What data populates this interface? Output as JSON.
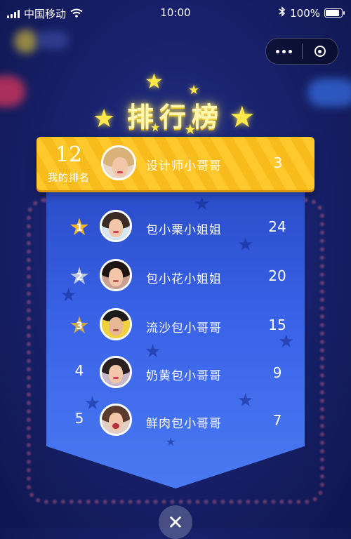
{
  "status_bar": {
    "carrier": "中国移动",
    "time": "10:00",
    "battery": "100%",
    "battery_level": 1.0
  },
  "capsule": {
    "more_icon": "more-dots-icon",
    "close_icon": "target-circle-icon"
  },
  "title": "排行榜",
  "my_rank": {
    "rank": "12",
    "label": "我的排名",
    "name": "设计师小哥哥",
    "score": "3"
  },
  "rows": [
    {
      "rank": "1",
      "medal": "gold",
      "name": "包小栗小姐姐",
      "score": "24"
    },
    {
      "rank": "2",
      "medal": "silver",
      "name": "包小花小姐姐",
      "score": "20"
    },
    {
      "rank": "3",
      "medal": "bronze",
      "name": "流沙包小哥哥",
      "score": "15"
    },
    {
      "rank": "4",
      "medal": "",
      "name": "奶黄包小哥哥",
      "score": "9"
    },
    {
      "rank": "5",
      "medal": "",
      "name": "鲜肉包小哥哥",
      "score": "7"
    }
  ],
  "colors": {
    "gold": "#f5b823",
    "silver": "#b9c8dd",
    "bronze": "#c9a74a",
    "banner": "#ffc92e"
  },
  "close_label": "✕"
}
